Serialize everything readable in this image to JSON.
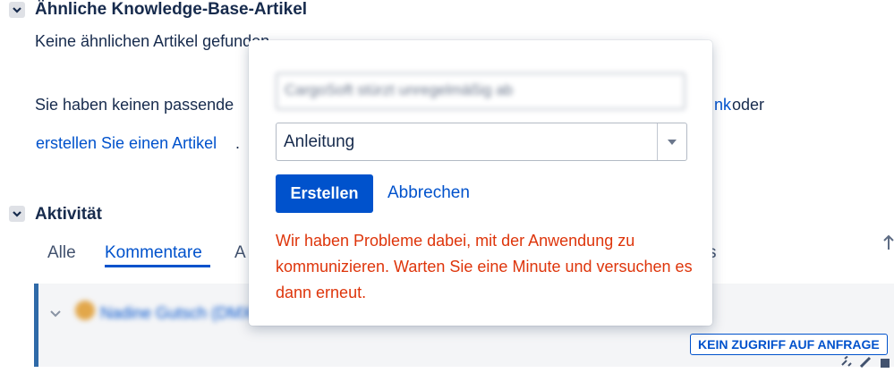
{
  "similar_kb": {
    "title": "Ähnliche Knowledge-Base-Artikel",
    "no_results": "Keine ähnlichen Artikel gefunden.",
    "hint_text_start": "Sie haben keinen passende",
    "hint_link_fragment": "nk",
    "hint_text_end": "oder",
    "create_link": "erstellen Sie einen Artikel",
    "create_suffix": "."
  },
  "activity": {
    "title": "Aktivität",
    "tabs": [
      {
        "label": "Alle",
        "active": false
      },
      {
        "label": "Kommentare",
        "active": true
      },
      {
        "label": "A",
        "active": false
      },
      {
        "label": "s",
        "active": false
      }
    ],
    "comment_author": "Nadine Gutsch (DMX",
    "no_access_badge": "KEIN ZUGRIFF AUF ANFRAGE"
  },
  "popup": {
    "title_input_value": "CargoSoft stürzt unregelmäßig ab",
    "type_select_value": "Anleitung",
    "create_button": "Erstellen",
    "cancel_link": "Abbrechen",
    "error_message": "Wir haben Probleme dabei, mit der Anwendung zu kommunizieren. Warten Sie eine Minute und versuchen es dann erneut."
  },
  "colors": {
    "primary": "#0052cc",
    "error": "#de350b",
    "text": "#172b4d"
  },
  "icons": {
    "section_toggle": "chevron-down-icon",
    "select_arrow": "caret-down-icon",
    "sort": "arrow-up-icon",
    "link": "link-icon",
    "edit": "pencil-icon",
    "delete": "trash-icon"
  }
}
